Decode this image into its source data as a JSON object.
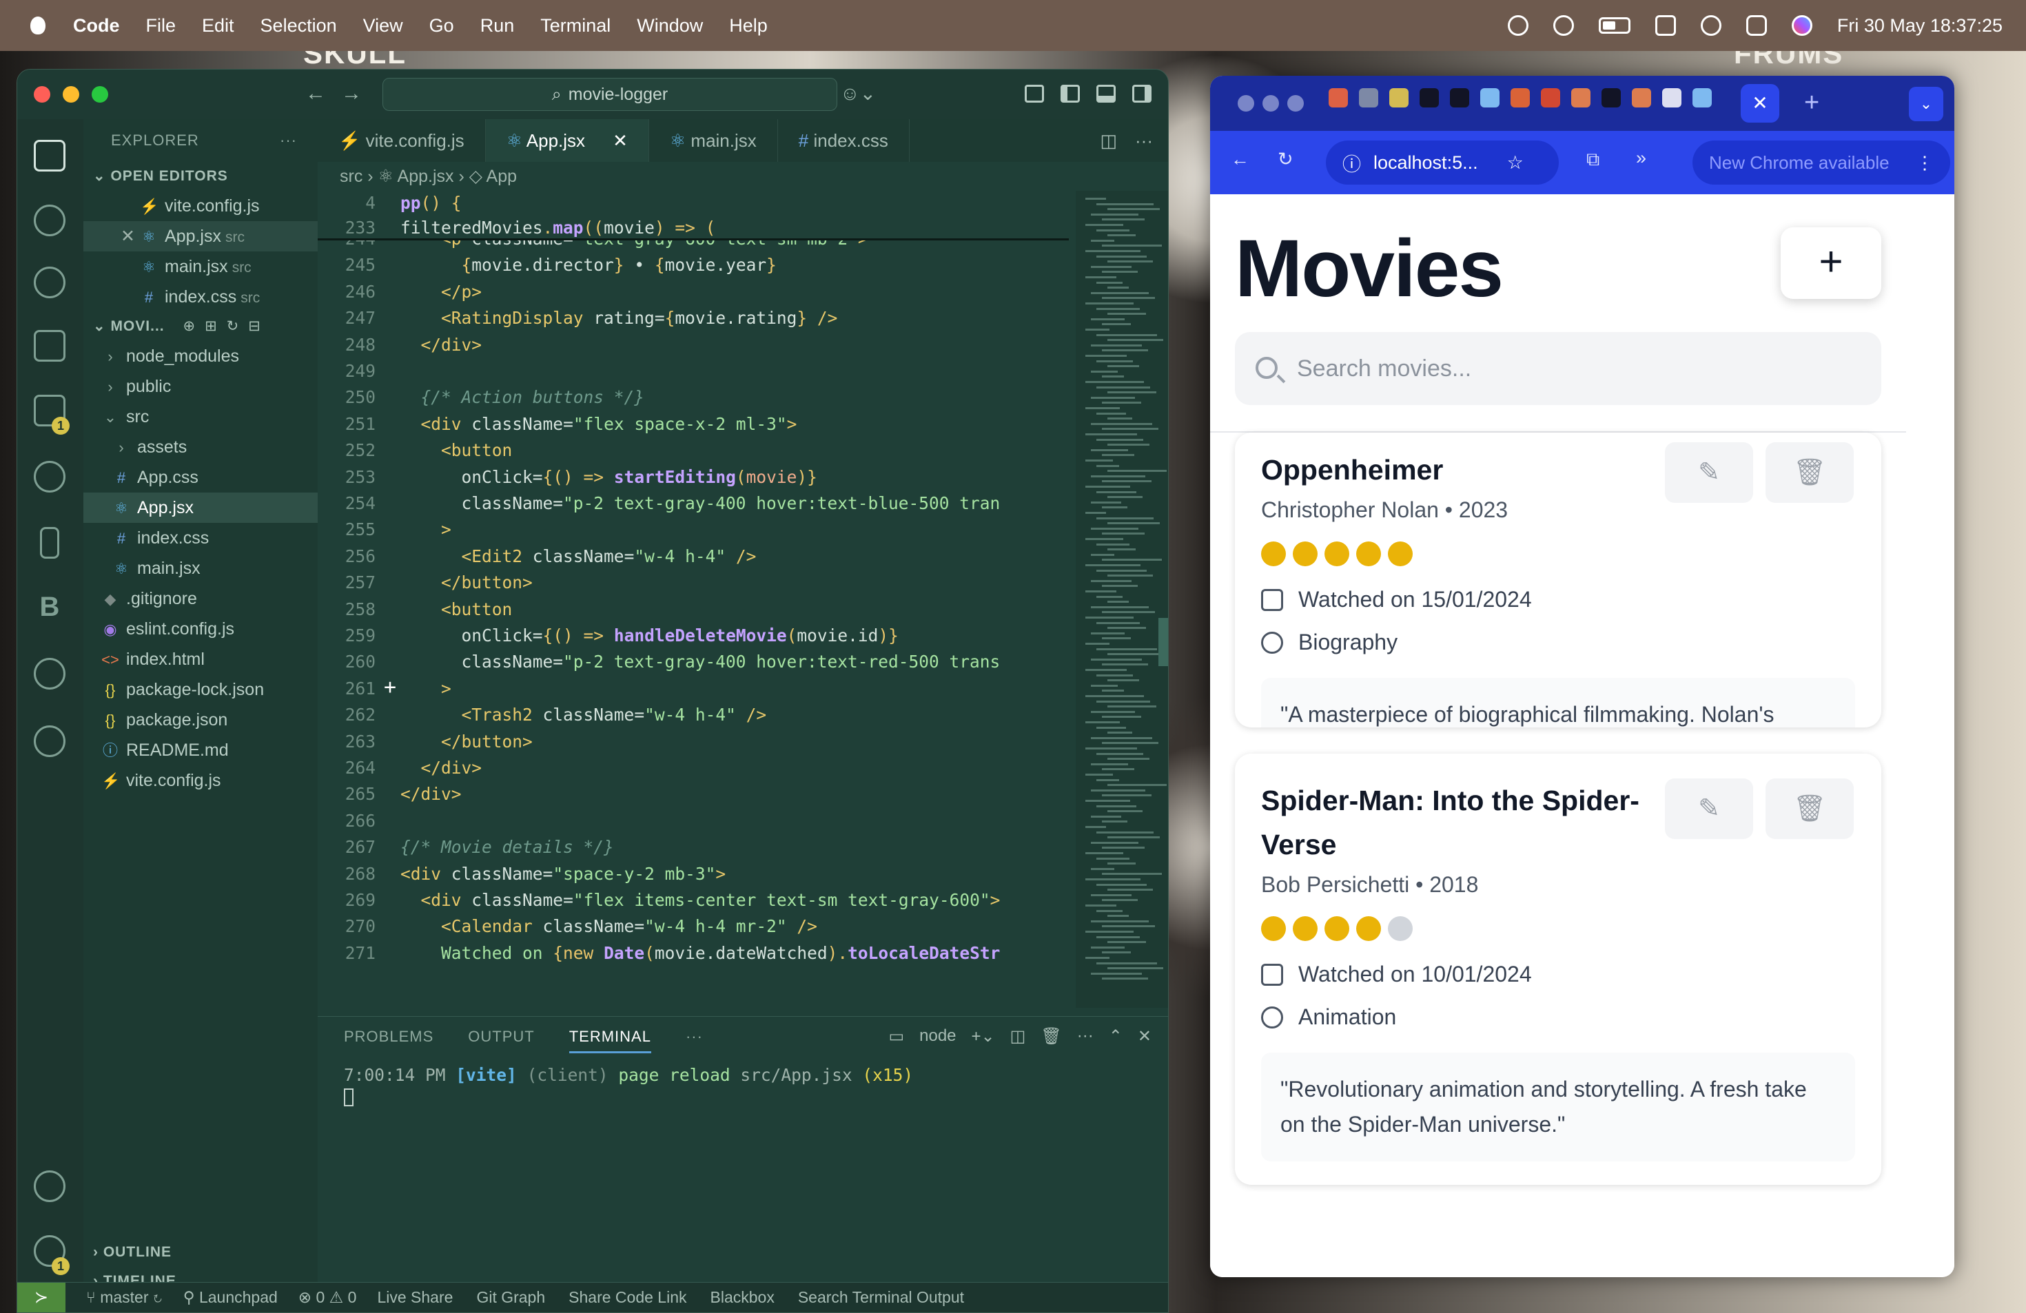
{
  "menubar": {
    "app": "Code",
    "items": [
      "File",
      "Edit",
      "Selection",
      "View",
      "Go",
      "Run",
      "Terminal",
      "Window",
      "Help"
    ],
    "clock": "Fri 30 May  18:37:25"
  },
  "wallpaper": {
    "left_poster": "SKULL",
    "right_poster": "FRUMS"
  },
  "vscode": {
    "search_label": "movie-logger",
    "explorer_title": "EXPLORER",
    "open_editors_title": "OPEN EDITORS",
    "open_editors": [
      {
        "name": "vite.config.js",
        "hint": "",
        "icon": "⚡",
        "color": "#e8d44d"
      },
      {
        "name": "App.jsx",
        "hint": "src",
        "icon": "⚛",
        "color": "#62b6e8"
      },
      {
        "name": "main.jsx",
        "hint": "src",
        "icon": "⚛",
        "color": "#62b6e8"
      },
      {
        "name": "index.css",
        "hint": "src",
        "icon": "#",
        "color": "#6ea3e0"
      }
    ],
    "project_title": "MOVI...",
    "files": [
      {
        "name": "node_modules",
        "indent": 1,
        "icon": "›",
        "color": "#8fa99f"
      },
      {
        "name": "public",
        "indent": 1,
        "icon": "›",
        "color": "#8fa99f"
      },
      {
        "name": "src",
        "indent": 1,
        "icon": "⌄",
        "color": "#8fa99f"
      },
      {
        "name": "assets",
        "indent": 2,
        "icon": "›",
        "color": "#8fa99f"
      },
      {
        "name": "App.css",
        "indent": 2,
        "icon": "#",
        "color": "#6ea3e0"
      },
      {
        "name": "App.jsx",
        "indent": 2,
        "icon": "⚛",
        "color": "#62b6e8"
      },
      {
        "name": "index.css",
        "indent": 2,
        "icon": "#",
        "color": "#6ea3e0"
      },
      {
        "name": "main.jsx",
        "indent": 2,
        "icon": "⚛",
        "color": "#62b6e8"
      },
      {
        "name": ".gitignore",
        "indent": 1,
        "icon": "◆",
        "color": "#7c8a86"
      },
      {
        "name": "eslint.config.js",
        "indent": 1,
        "icon": "◉",
        "color": "#a27be8"
      },
      {
        "name": "index.html",
        "indent": 1,
        "icon": "<>",
        "color": "#e8794d"
      },
      {
        "name": "package-lock.json",
        "indent": 1,
        "icon": "{}",
        "color": "#e8d44d"
      },
      {
        "name": "package.json",
        "indent": 1,
        "icon": "{}",
        "color": "#e8d44d"
      },
      {
        "name": "README.md",
        "indent": 1,
        "icon": "ⓘ",
        "color": "#62b6e8"
      },
      {
        "name": "vite.config.js",
        "indent": 1,
        "icon": "⚡",
        "color": "#e8d44d"
      }
    ],
    "outline_title": "OUTLINE",
    "timeline_title": "TIMELINE",
    "tabs": [
      {
        "name": "vite.config.js",
        "icon": "⚡",
        "color": "#e8d44d"
      },
      {
        "name": "App.jsx",
        "icon": "⚛",
        "color": "#62b6e8"
      },
      {
        "name": "main.jsx",
        "icon": "⚛",
        "color": "#62b6e8"
      },
      {
        "name": "index.css",
        "icon": "#",
        "color": "#6ea3e0"
      }
    ],
    "breadcrumb": [
      "src",
      "App.jsx",
      "App"
    ],
    "sticky_lines": [
      {
        "num": "4",
        "html": "<span class='fn'>pp</span><span class='kw'>() {</span>"
      },
      {
        "num": "233",
        "html": "<span class='pl'>filteredMovies</span><span class='kw'>.</span><span class='fn'>map</span><span class='kw'>((</span><span class='pl'>movie</span><span class='kw'>) =&gt; (</span>"
      }
    ],
    "code_lines": [
      {
        "num": "244",
        "html": "    <span class='tag'>&lt;p</span> <span class='attr'>className</span>=<span class='str'>\"text-gray-600 text-sm mb-2\"</span><span class='tag'>&gt;</span>"
      },
      {
        "num": "245",
        "html": "      <span class='kw'>{</span><span class='pl'>movie.director</span><span class='kw'>}</span> • <span class='kw'>{</span><span class='pl'>movie.year</span><span class='kw'>}</span>"
      },
      {
        "num": "246",
        "html": "    <span class='tag'>&lt;/p&gt;</span>"
      },
      {
        "num": "247",
        "html": "    <span class='tag'>&lt;RatingDisplay</span> <span class='attr'>rating</span>=<span class='kw'>{</span><span class='pl'>movie.rating</span><span class='kw'>}</span> <span class='tag'>/&gt;</span>"
      },
      {
        "num": "248",
        "html": "  <span class='tag'>&lt;/div&gt;</span>"
      },
      {
        "num": "249",
        "html": ""
      },
      {
        "num": "250",
        "html": "  <span class='cm'>{/* Action buttons */}</span>"
      },
      {
        "num": "251",
        "html": "  <span class='tag'>&lt;div</span> <span class='attr'>className</span>=<span class='str'>\"flex space-x-2 ml-3\"</span><span class='tag'>&gt;</span>"
      },
      {
        "num": "252",
        "html": "    <span class='tag'>&lt;button</span>"
      },
      {
        "num": "253",
        "html": "      <span class='attr'>onClick</span>=<span class='kw'>{() =&gt;</span> <span class='fn'>startEditing</span><span class='kw'>(</span><span class='var'>movie</span><span class='kw'>)}</span>"
      },
      {
        "num": "254",
        "html": "      <span class='attr'>className</span>=<span class='str'>\"p-2 text-gray-400 hover:text-blue-500 tran</span>"
      },
      {
        "num": "255",
        "html": "    <span class='tag'>&gt;</span>"
      },
      {
        "num": "256",
        "html": "      <span class='tag'>&lt;Edit2</span> <span class='attr'>className</span>=<span class='str'>\"w-4 h-4\"</span> <span class='tag'>/&gt;</span>"
      },
      {
        "num": "257",
        "html": "    <span class='tag'>&lt;/button&gt;</span>"
      },
      {
        "num": "258",
        "html": "    <span class='tag'>&lt;button</span>"
      },
      {
        "num": "259",
        "html": "      <span class='attr'>onClick</span>=<span class='kw'>{() =&gt;</span> <span class='fn'>handleDeleteMovie</span><span class='kw'>(</span><span class='pl'>movie.id</span><span class='kw'>)}</span>"
      },
      {
        "num": "260",
        "html": "      <span class='attr'>className</span>=<span class='str'>\"p-2 text-gray-400 hover:text-red-500 trans</span>"
      },
      {
        "num": "261",
        "html": "    <span class='tag'>&gt;</span>"
      },
      {
        "num": "262",
        "html": "      <span class='tag'>&lt;Trash2</span> <span class='attr'>className</span>=<span class='str'>\"w-4 h-4\"</span> <span class='tag'>/&gt;</span>"
      },
      {
        "num": "263",
        "html": "    <span class='tag'>&lt;/button&gt;</span>"
      },
      {
        "num": "264",
        "html": "  <span class='tag'>&lt;/div&gt;</span>"
      },
      {
        "num": "265",
        "html": "<span class='tag'>&lt;/div&gt;</span>"
      },
      {
        "num": "266",
        "html": ""
      },
      {
        "num": "267",
        "html": "<span class='cm'>{/* Movie details */}</span>"
      },
      {
        "num": "268",
        "html": "<span class='tag'>&lt;div</span> <span class='attr'>className</span>=<span class='str'>\"space-y-2 mb-3\"</span><span class='tag'>&gt;</span>"
      },
      {
        "num": "269",
        "html": "  <span class='tag'>&lt;div</span> <span class='attr'>className</span>=<span class='str'>\"flex items-center text-sm text-gray-600\"</span><span class='tag'>&gt;</span>"
      },
      {
        "num": "270",
        "html": "    <span class='tag'>&lt;Calendar</span> <span class='attr'>className</span>=<span class='str'>\"w-4 h-4 mr-2\"</span> <span class='tag'>/&gt;</span>"
      },
      {
        "num": "271",
        "html": "    <span class='str'>Watched on </span><span class='kw'>{new</span> <span class='fn'>Date</span><span class='kw'>(</span><span class='pl'>movie.dateWatched</span><span class='kw'>).</span><span class='fn'>toLocaleDateStr</span>"
      }
    ],
    "panel_tabs": [
      "PROBLEMS",
      "OUTPUT",
      "TERMINAL"
    ],
    "terminal_shell": "node",
    "terminal_line": "<span style='color:#9fb3ab'>7:00:14 PM</span> <span style='color:#62b6e8;font-weight:700'>[vite]</span> <span style='color:#7f978e'>(client)</span> <span style='color:#a6e3a1'>page reload</span> <span style='color:#9fb3ab'>src/App.jsx</span> <span style='color:#e8d44d'>(x15)</span>",
    "status": {
      "branch": "master",
      "launchpad": "Launchpad",
      "errors": "0",
      "warnings": "0",
      "items": [
        "Live Share",
        "Git Graph",
        "Share Code Link",
        "Blackbox",
        "Search Terminal Output"
      ]
    }
  },
  "chrome": {
    "url": "localhost:5...",
    "update_label": "New Chrome available",
    "page": {
      "title": "Movies",
      "add_label": "+",
      "search_placeholder": "Search movies...",
      "movies": [
        {
          "title": "Oppenheimer",
          "director_year": "Christopher Nolan • 2023",
          "rating": 5,
          "watched": "Watched on 15/01/2024",
          "genre": "Biography",
          "review": "\"A masterpiece of biographical filmmaking. Nolan's direction is impeccable.\""
        },
        {
          "title": "Spider-Man: Into the Spider-Verse",
          "director_year": "Bob Persichetti • 2018",
          "rating": 4,
          "watched": "Watched on 10/01/2024",
          "genre": "Animation",
          "review": "\"Revolutionary animation and storytelling. A fresh take on the Spider-Man universe.\""
        }
      ]
    }
  }
}
